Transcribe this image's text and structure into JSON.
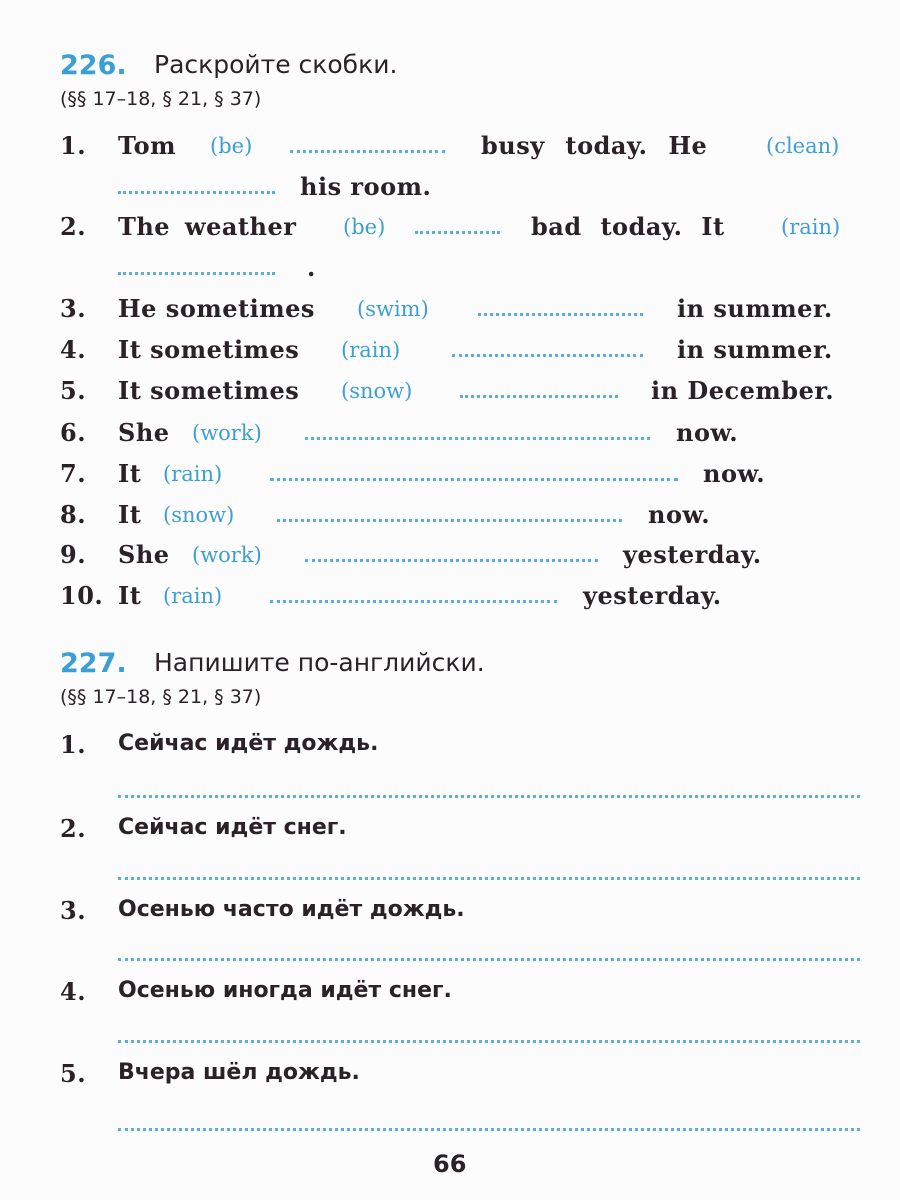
{
  "ex226": {
    "number": "226.",
    "instruction": "Раскройте скобки.",
    "refs": "(§§ 17–18, § 21, § 37)",
    "items": [
      {
        "n": "1.",
        "a": "Tom",
        "h1": "(be)",
        "b": "busy today. He",
        "h2": "(clean)",
        "c": "his room."
      },
      {
        "n": "2.",
        "a": "The weather",
        "h1": "(be)",
        "b": "bad today. It",
        "h2": "(rain)",
        "c": "."
      },
      {
        "n": "3.",
        "a": "He sometimes",
        "h": "(swim)",
        "b": "in summer."
      },
      {
        "n": "4.",
        "a": "It sometimes",
        "h": "(rain)",
        "b": "in summer."
      },
      {
        "n": "5.",
        "a": "It sometimes",
        "h": "(snow)",
        "b": "in December."
      },
      {
        "n": "6.",
        "a": "She",
        "h": "(work)",
        "b": "now."
      },
      {
        "n": "7.",
        "a": "It",
        "h": "(rain)",
        "b": "now."
      },
      {
        "n": "8.",
        "a": "It",
        "h": "(snow)",
        "b": "now."
      },
      {
        "n": "9.",
        "a": "She",
        "h": "(work)",
        "b": "yesterday."
      },
      {
        "n": "10.",
        "a": "It",
        "h": "(rain)",
        "b": "yesterday."
      }
    ]
  },
  "ex227": {
    "number": "227.",
    "instruction": "Напишите по-английски.",
    "refs": "(§§ 17–18, § 21, § 37)",
    "items": [
      {
        "n": "1.",
        "t": "Сейчас идёт дождь."
      },
      {
        "n": "2.",
        "t": "Сейчас идёт снег."
      },
      {
        "n": "3.",
        "t": "Осенью часто идёт дождь."
      },
      {
        "n": "4.",
        "t": "Осенью иногда идёт снег."
      },
      {
        "n": "5.",
        "t": "Вчера шёл дождь."
      }
    ]
  },
  "page_number": "66",
  "colors": {
    "accent": "#3a9fd4",
    "text": "#2b2227"
  }
}
